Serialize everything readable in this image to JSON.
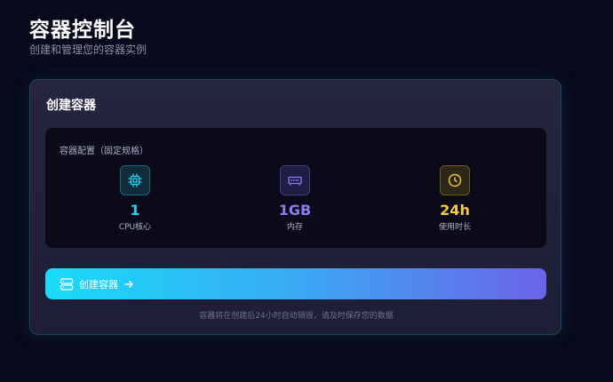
{
  "header": {
    "title": "容器控制台",
    "subtitle": "创建和管理您的容器实例"
  },
  "card": {
    "title": "创建容器",
    "config_label": "容器配置（固定规格）",
    "specs": [
      {
        "icon": "cpu-icon",
        "value": "1",
        "caption": "CPU核心",
        "color": "#22d4f0"
      },
      {
        "icon": "memory-icon",
        "value": "1GB",
        "caption": "内存",
        "color": "#8b7cf6"
      },
      {
        "icon": "clock-icon",
        "value": "24h",
        "caption": "使用时长",
        "color": "#f7c948"
      }
    ],
    "create_button": {
      "label": "创建容器",
      "icon": "server-icon",
      "trailing_icon": "arrow-right-icon"
    },
    "footnote": "容器将在创建后24小时自动销毁，请及时保存您的数据"
  }
}
